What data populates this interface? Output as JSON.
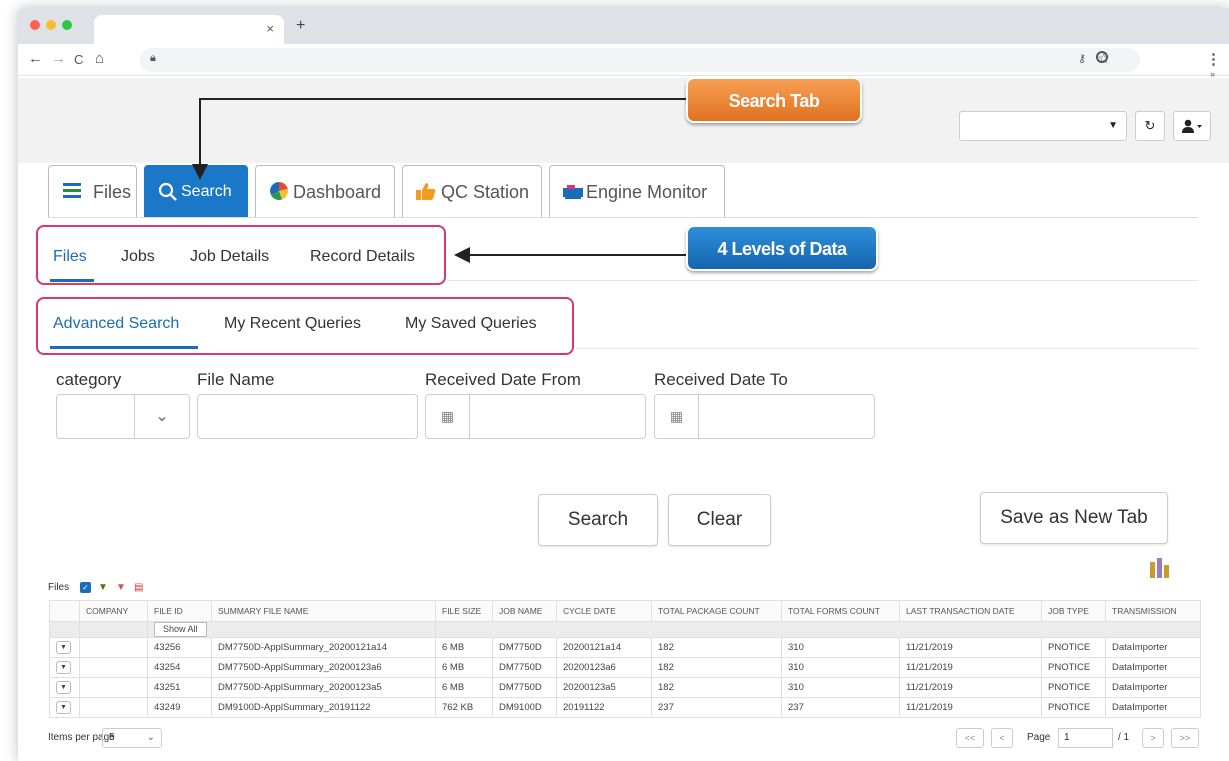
{
  "browser": {
    "close_tab": "×",
    "new_tab": "+",
    "nav": {
      "back": "←",
      "forward": "→",
      "reload": "C",
      "home": "⌂"
    }
  },
  "header": {
    "refresh_icon": "↻",
    "user_icon": "user-icon"
  },
  "main_tabs": [
    {
      "label": "Files",
      "icon": "list-icon"
    },
    {
      "label": "Search",
      "icon": "search-icon"
    },
    {
      "label": "Dashboard",
      "icon": "pie-chart-icon"
    },
    {
      "label": "QC Station",
      "icon": "thumbs-up-icon"
    },
    {
      "label": "Engine Monitor",
      "icon": "monitor-icon"
    }
  ],
  "level_tabs": [
    "Files",
    "Jobs",
    "Job Details",
    "Record Details"
  ],
  "query_tabs": [
    "Advanced Search",
    "My Recent Queries",
    "My Saved Queries"
  ],
  "form": {
    "category_label": "category",
    "file_name_label": "File Name",
    "received_from_label": "Received Date From",
    "received_to_label": "Received Date To"
  },
  "buttons": {
    "search": "Search",
    "clear": "Clear",
    "save_new_tab": "Save as New Tab"
  },
  "grid_tools": {
    "label": "Files"
  },
  "table": {
    "headers": [
      "",
      "COMPANY",
      "FILE ID",
      "SUMMARY FILE NAME",
      "FILE SIZE",
      "JOB NAME",
      "CYCLE DATE",
      "TOTAL PACKAGE COUNT",
      "TOTAL FORMS COUNT",
      "LAST TRANSACTION DATE",
      "JOB TYPE",
      "TRANSMISSION"
    ],
    "show_all": "Show All",
    "rows": [
      [
        "",
        "43256",
        "DM7750D-ApplSummary_20200121a14",
        "6 MB",
        "DM7750D",
        "20200121a14",
        "182",
        "310",
        "11/21/2019",
        "PNOTICE",
        "DataImporter"
      ],
      [
        "",
        "43254",
        "DM7750D-ApplSummary_20200123a6",
        "6 MB",
        "DM7750D",
        "20200123a6",
        "182",
        "310",
        "11/21/2019",
        "PNOTICE",
        "DataImporter"
      ],
      [
        "",
        "43251",
        "DM7750D-ApplSummary_20200123a5",
        "6 MB",
        "DM7750D",
        "20200123a5",
        "182",
        "310",
        "11/21/2019",
        "PNOTICE",
        "DataImporter"
      ],
      [
        "",
        "43249",
        "DM9100D-ApplSummary_20191122",
        "762 KB",
        "DM9100D",
        "20191122",
        "237",
        "237",
        "11/21/2019",
        "PNOTICE",
        "DataImporter"
      ]
    ]
  },
  "pager": {
    "items_per_page_label": "Items per page",
    "items_per_page": "5",
    "first": "<<",
    "prev": "<",
    "page_label": "Page",
    "page": "1",
    "of_total": "/ 1",
    "next": ">",
    "last": ">>"
  },
  "callouts": {
    "search_tab": "Search Tab",
    "levels": "4 Levels of Data"
  },
  "colors": {
    "accent": "#1b78c8",
    "highlight": "#d93672",
    "callout_orange": "#e0711f",
    "callout_blue": "#1565ad"
  }
}
